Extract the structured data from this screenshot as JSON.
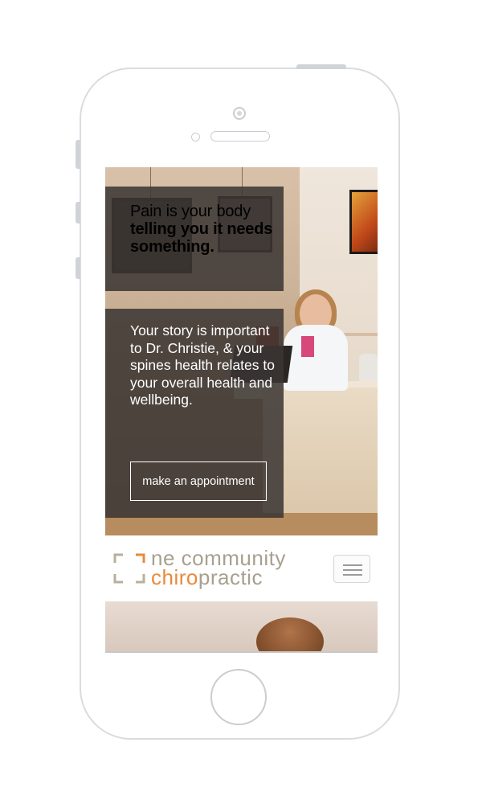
{
  "hero": {
    "headline_light": "Pain is your body",
    "headline_bold": "telling you it needs something.",
    "body": "Your story is important to Dr. Christie, & your spines health relates to your overall health and wellbeing.",
    "cta_label": "make an appointment"
  },
  "header": {
    "logo_line1": "ne community",
    "logo_accent": "chiro",
    "logo_rest": "practic",
    "menu_icon": "hamburger-menu-icon"
  },
  "colors": {
    "panel_bg": "#3a3432",
    "logo_accent": "#e88a3a",
    "logo_text": "#a8a08f",
    "phone_outline": "#d9dcdf"
  }
}
